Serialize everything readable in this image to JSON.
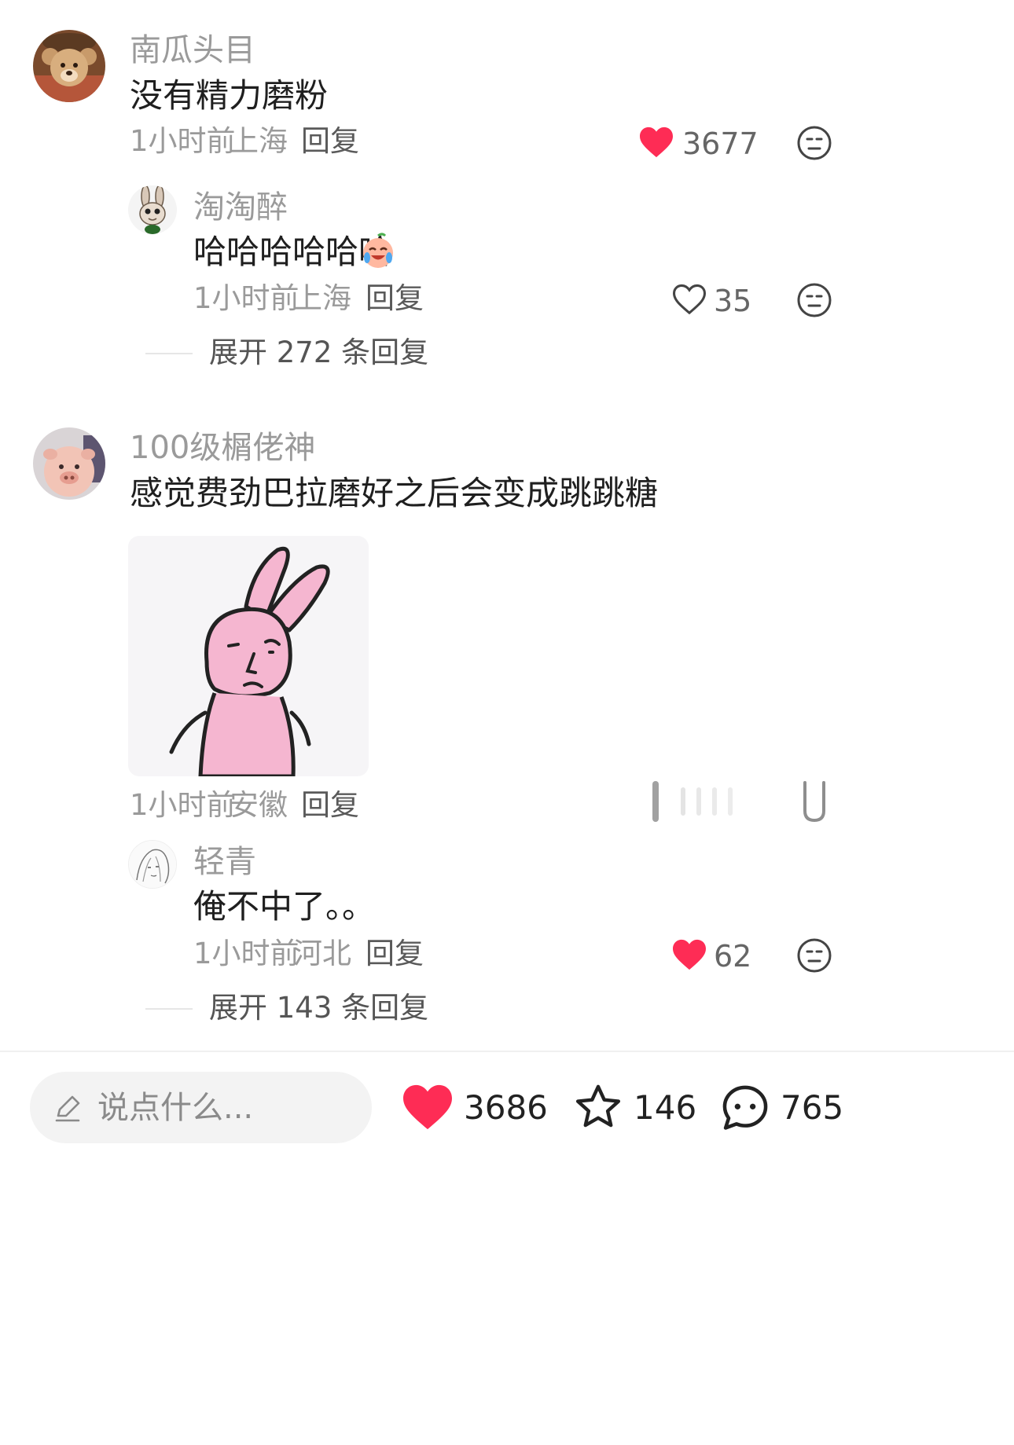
{
  "comments": [
    {
      "username": "南瓜头目",
      "text": "没有精力磨粉",
      "time": "1小时前",
      "location": "上海",
      "reply_label": "回复",
      "likes": "3677",
      "liked": true,
      "replies": [
        {
          "username": "淘淘醉",
          "text": "哈哈哈哈哈哈",
          "emoji": "crying-laughing-emoji",
          "time": "1小时前",
          "location": "上海",
          "reply_label": "回复",
          "likes": "35",
          "liked": false
        }
      ],
      "expand_label": "展开 272 条回复"
    },
    {
      "username": "100级榍佬神",
      "text": "感觉费劲巴拉磨好之后会变成跳跳糖",
      "sticker": "pink-rabbit-sticker",
      "time": "1小时前",
      "location": "安徽",
      "reply_label": "回复",
      "replies": [
        {
          "username": "轻青",
          "text": "俺不中了。。",
          "time": "1小时前",
          "location": "河北",
          "reply_label": "回复",
          "likes": "62",
          "liked": true
        }
      ],
      "expand_label": "展开 143 条回复"
    }
  ],
  "bottom_bar": {
    "input_placeholder": "说点什么...",
    "likes": "3686",
    "favorites": "146",
    "comments": "765"
  },
  "colors": {
    "like_red": "#fe2c55",
    "muted_text": "#9a9a9a",
    "input_bg": "#f3f3f3"
  }
}
